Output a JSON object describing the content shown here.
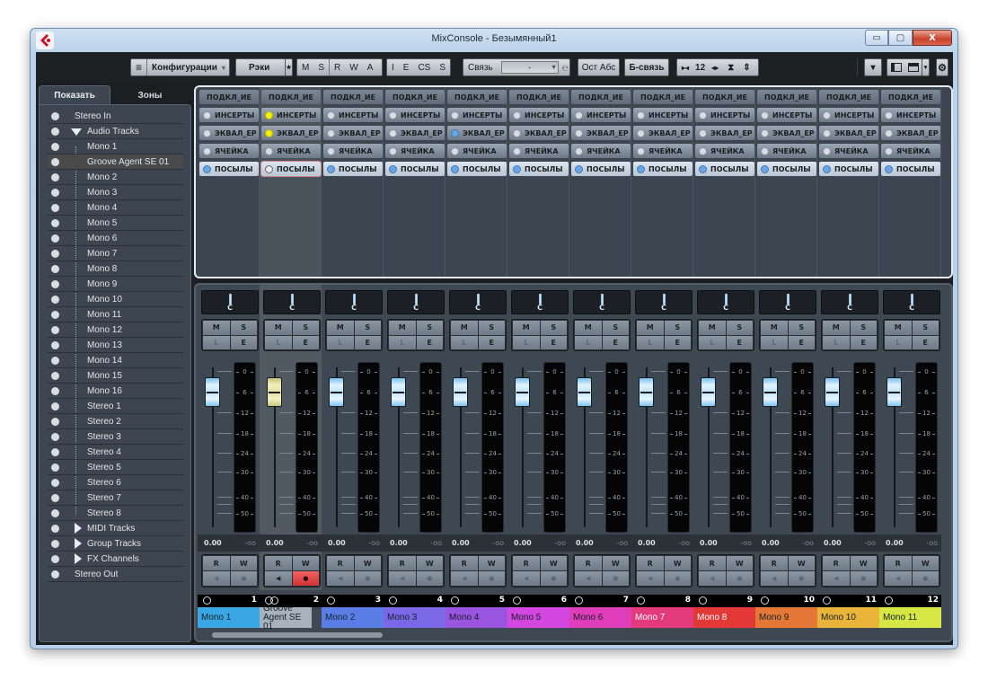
{
  "window": {
    "title": "MixConsole - Безымянный1",
    "minimize_glyph": "▭",
    "maximize_glyph": "▢",
    "close_glyph": "X"
  },
  "toolbar": {
    "config_icon": "≡",
    "config_label": "Конфигурации",
    "config_arrow": "▾",
    "racks_label": "Рэки",
    "racks_star": "★",
    "state_buttons": [
      "M",
      "S",
      "R",
      "W",
      "A"
    ],
    "view_buttons": [
      "I",
      "E",
      "CS",
      "S"
    ],
    "link_label": "Связь",
    "link_value": "-",
    "link_icon": "℮",
    "ost_abs_label": "Ост Абс",
    "qlink_label": "Б-связь",
    "channel_count": "12",
    "menu_arrow": "▾",
    "gear_icon": "⚙"
  },
  "left_panel": {
    "tabs": [
      {
        "label": "Показать",
        "active": true
      },
      {
        "label": "Зоны",
        "active": false
      }
    ],
    "items": [
      {
        "label": "Stereo In",
        "level": 0,
        "expander": "none"
      },
      {
        "label": "Audio Tracks",
        "level": 0,
        "expander": "open"
      },
      {
        "label": "Mono 1",
        "level": 1
      },
      {
        "label": "Groove Agent SE 01",
        "level": 1,
        "selected": true
      },
      {
        "label": "Mono 2",
        "level": 1
      },
      {
        "label": "Mono 3",
        "level": 1
      },
      {
        "label": "Mono 4",
        "level": 1
      },
      {
        "label": "Mono 5",
        "level": 1
      },
      {
        "label": "Mono 6",
        "level": 1
      },
      {
        "label": "Mono 7",
        "level": 1
      },
      {
        "label": "Mono 8",
        "level": 1
      },
      {
        "label": "Mono 9",
        "level": 1
      },
      {
        "label": "Mono 10",
        "level": 1
      },
      {
        "label": "Mono 11",
        "level": 1
      },
      {
        "label": "Mono 12",
        "level": 1
      },
      {
        "label": "Mono 13",
        "level": 1
      },
      {
        "label": "Mono 14",
        "level": 1
      },
      {
        "label": "Mono 15",
        "level": 1
      },
      {
        "label": "Mono 16",
        "level": 1
      },
      {
        "label": "Stereo 1",
        "level": 1
      },
      {
        "label": "Stereo 2",
        "level": 1
      },
      {
        "label": "Stereo 3",
        "level": 1
      },
      {
        "label": "Stereo 4",
        "level": 1
      },
      {
        "label": "Stereo 5",
        "level": 1
      },
      {
        "label": "Stereo 6",
        "level": 1
      },
      {
        "label": "Stereo 7",
        "level": 1
      },
      {
        "label": "Stereo 8",
        "level": 1
      },
      {
        "label": "MIDI Tracks",
        "level": 0,
        "expander": "closed"
      },
      {
        "label": "Group Tracks",
        "level": 0,
        "expander": "closed"
      },
      {
        "label": "FX Channels",
        "level": 0,
        "expander": "closed"
      },
      {
        "label": "Stereo Out",
        "level": 0,
        "expander": "none"
      }
    ]
  },
  "routing": {
    "header_label": "ПОДКЛ_ИЕ",
    "inserts_label": "ИНСЕРТЫ",
    "eq_label": "ЭКВАЛ_ЕР",
    "strip_label": "ЯЧЕЙКА",
    "sends_label": "ПОСЫЛЫ"
  },
  "channels": [
    {
      "number": "1",
      "name": "Mono 1",
      "color": "#3aa6e3",
      "text_color": "#14202a",
      "stereo": false,
      "selected": false,
      "inserts_led": "gray",
      "eq_led": "gray",
      "strip_led": "gray",
      "sends_led": "blue",
      "pan": "C",
      "volume": "0.00",
      "peak": "-oo",
      "fader_db": 6,
      "record_enabled": false
    },
    {
      "number": "2",
      "name": "Groove Agent SE 01",
      "color": "#a8b2bc",
      "text_color": "#14202a",
      "stereo": true,
      "selected": true,
      "inserts_led": "yellow",
      "eq_led": "yellow",
      "strip_led": "gray",
      "sends_led": "empty",
      "pan": "C",
      "volume": "0.00",
      "peak": "-oo",
      "fader_db": 6,
      "record_enabled": true
    },
    {
      "number": "3",
      "name": "Mono 2",
      "color": "#5b7ee6",
      "text_color": "#14202a",
      "stereo": false,
      "selected": false,
      "inserts_led": "gray",
      "eq_led": "gray",
      "strip_led": "gray",
      "sends_led": "blue",
      "pan": "C",
      "volume": "0.00",
      "peak": "-oo",
      "fader_db": 6,
      "record_enabled": false
    },
    {
      "number": "4",
      "name": "Mono 3",
      "color": "#7a68e6",
      "text_color": "#14202a",
      "stereo": false,
      "selected": false,
      "inserts_led": "gray",
      "eq_led": "gray",
      "strip_led": "gray",
      "sends_led": "blue",
      "pan": "C",
      "volume": "0.00",
      "peak": "-oo",
      "fader_db": 6,
      "record_enabled": false
    },
    {
      "number": "5",
      "name": "Mono 4",
      "color": "#9a55e0",
      "text_color": "#14202a",
      "stereo": false,
      "selected": false,
      "inserts_led": "gray",
      "eq_led": "blue",
      "strip_led": "gray",
      "sends_led": "blue",
      "pan": "C",
      "volume": "0.00",
      "peak": "-oo",
      "fader_db": 6,
      "record_enabled": false
    },
    {
      "number": "6",
      "name": "Mono 5",
      "color": "#d446e0",
      "text_color": "#14202a",
      "stereo": false,
      "selected": false,
      "inserts_led": "gray",
      "eq_led": "gray",
      "strip_led": "gray",
      "sends_led": "blue",
      "pan": "C",
      "volume": "0.00",
      "peak": "-oo",
      "fader_db": 6,
      "record_enabled": false
    },
    {
      "number": "7",
      "name": "Mono 6",
      "color": "#e03dba",
      "text_color": "#14202a",
      "stereo": false,
      "selected": false,
      "inserts_led": "gray",
      "eq_led": "gray",
      "strip_led": "gray",
      "sends_led": "blue",
      "pan": "C",
      "volume": "0.00",
      "peak": "-oo",
      "fader_db": 6,
      "record_enabled": false
    },
    {
      "number": "8",
      "name": "Mono 7",
      "color": "#e33a7c",
      "text_color": "#ffffff",
      "stereo": false,
      "selected": false,
      "inserts_led": "gray",
      "eq_led": "gray",
      "strip_led": "gray",
      "sends_led": "blue",
      "pan": "C",
      "volume": "0.00",
      "peak": "-oo",
      "fader_db": 6,
      "record_enabled": false
    },
    {
      "number": "9",
      "name": "Mono 8",
      "color": "#e33838",
      "text_color": "#ffffff",
      "stereo": false,
      "selected": false,
      "inserts_led": "gray",
      "eq_led": "gray",
      "strip_led": "gray",
      "sends_led": "blue",
      "pan": "C",
      "volume": "0.00",
      "peak": "-oo",
      "fader_db": 6,
      "record_enabled": false
    },
    {
      "number": "10",
      "name": "Mono 9",
      "color": "#e57836",
      "text_color": "#14202a",
      "stereo": false,
      "selected": false,
      "inserts_led": "gray",
      "eq_led": "gray",
      "strip_led": "gray",
      "sends_led": "blue",
      "pan": "C",
      "volume": "0.00",
      "peak": "-oo",
      "fader_db": 6,
      "record_enabled": false
    },
    {
      "number": "11",
      "name": "Mono 10",
      "color": "#e8b43a",
      "text_color": "#14202a",
      "stereo": false,
      "selected": false,
      "inserts_led": "gray",
      "eq_led": "gray",
      "strip_led": "gray",
      "sends_led": "blue",
      "pan": "C",
      "volume": "0.00",
      "peak": "-oo",
      "fader_db": 6,
      "record_enabled": false
    },
    {
      "number": "12",
      "name": "Mono 11",
      "color": "#d6e645",
      "text_color": "#14202a",
      "stereo": false,
      "selected": false,
      "inserts_led": "gray",
      "eq_led": "gray",
      "strip_led": "gray",
      "sends_led": "blue",
      "pan": "C",
      "volume": "0.00",
      "peak": "-oo",
      "fader_db": 6,
      "record_enabled": false
    }
  ],
  "mixer": {
    "meter_scale": [
      "0",
      "6",
      "12",
      "18",
      "24",
      "30",
      "40",
      "50"
    ],
    "mute_label": "M",
    "solo_label": "S",
    "listen_label": "L",
    "edit_label": "E",
    "read_label": "R",
    "write_label": "W",
    "monitor_glyph": "◀",
    "record_glyph": "●"
  }
}
